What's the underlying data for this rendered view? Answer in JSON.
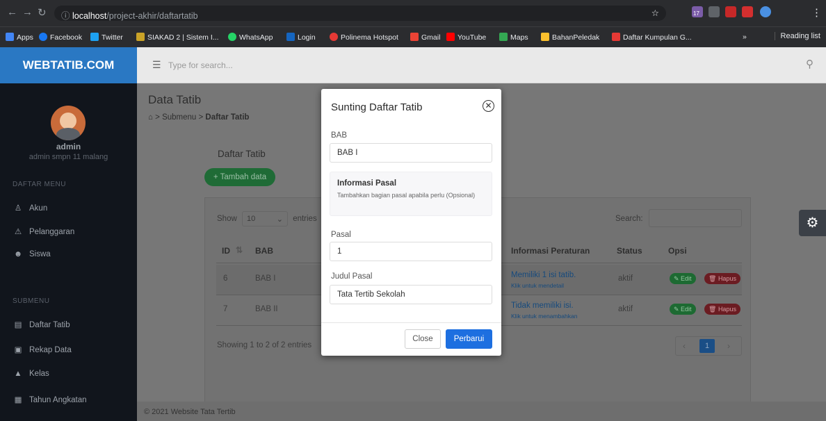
{
  "browser": {
    "url_host": "localhost",
    "url_path": "/project-akhir/daftartatib",
    "badge": "17",
    "bookmarks": [
      "Apps",
      "Facebook",
      "Twitter",
      "SIAKAD 2 | Sistem I...",
      "WhatsApp",
      "Login",
      "Polinema Hotspot",
      "Gmail",
      "YouTube",
      "Maps",
      "BahanPeledak",
      "Daftar Kumpulan G..."
    ],
    "more": "»",
    "reading_list": "Reading list"
  },
  "app": {
    "brand": "WEBTATIB.COM",
    "search_placeholder": "Type for search..."
  },
  "user": {
    "name": "admin",
    "role": "admin smpn 11 malang"
  },
  "sidebar": {
    "menu_header": "DAFTAR MENU",
    "menu": [
      "Akun",
      "Pelanggaran",
      "Siswa"
    ],
    "sub_header": "SUBMENU",
    "submenu": [
      "Daftar Tatib",
      "Rekap Data",
      "Kelas",
      "Tahun Angkatan"
    ]
  },
  "page": {
    "title": "Data Tatib",
    "breadcrumb_parent": "Submenu",
    "breadcrumb_current": "Daftar Tatib",
    "card_title": "Daftar Tatib",
    "add_button": "+ Tambah data",
    "show_label": "Show",
    "entries_value": "10",
    "entries_label": "entries",
    "search_label": "Search:",
    "columns": [
      "ID",
      "BAB",
      "Informasi Peraturan",
      "Status",
      "Opsi"
    ],
    "rows": [
      {
        "id": "6",
        "bab": "BAB I",
        "info": "Memiliki 1 isi tatib.",
        "info_sub": "Klik untuk mendetail",
        "status": "aktif"
      },
      {
        "id": "7",
        "bab": "BAB II",
        "info": "Tidak memiliki isi.",
        "info_sub": "Klik untuk menambahkan",
        "status": "aktif"
      }
    ],
    "edit_label": "Edit",
    "delete_label": "Hapus",
    "showing": "Showing 1 to 2 of 2 entries",
    "page_number": "1",
    "footer": "© 2021 Website Tata Tertib"
  },
  "modal": {
    "title": "Sunting Daftar Tatib",
    "bab_label": "BAB",
    "bab_value": "BAB I",
    "info_title": "Informasi Pasal",
    "info_text": "Tambahkan bagian pasal apabila perlu (Opsional)",
    "pasal_label": "Pasal",
    "pasal_value": "1",
    "judul_label": "Judul Pasal",
    "judul_value": "Tata Tertib Sekolah",
    "close_label": "Close",
    "submit_label": "Perbarui"
  },
  "colors": {
    "brand": "#2a78c3",
    "sidebar": "#11151c",
    "success": "#28a745",
    "danger": "#dc3545",
    "primary": "#0d6efd"
  }
}
